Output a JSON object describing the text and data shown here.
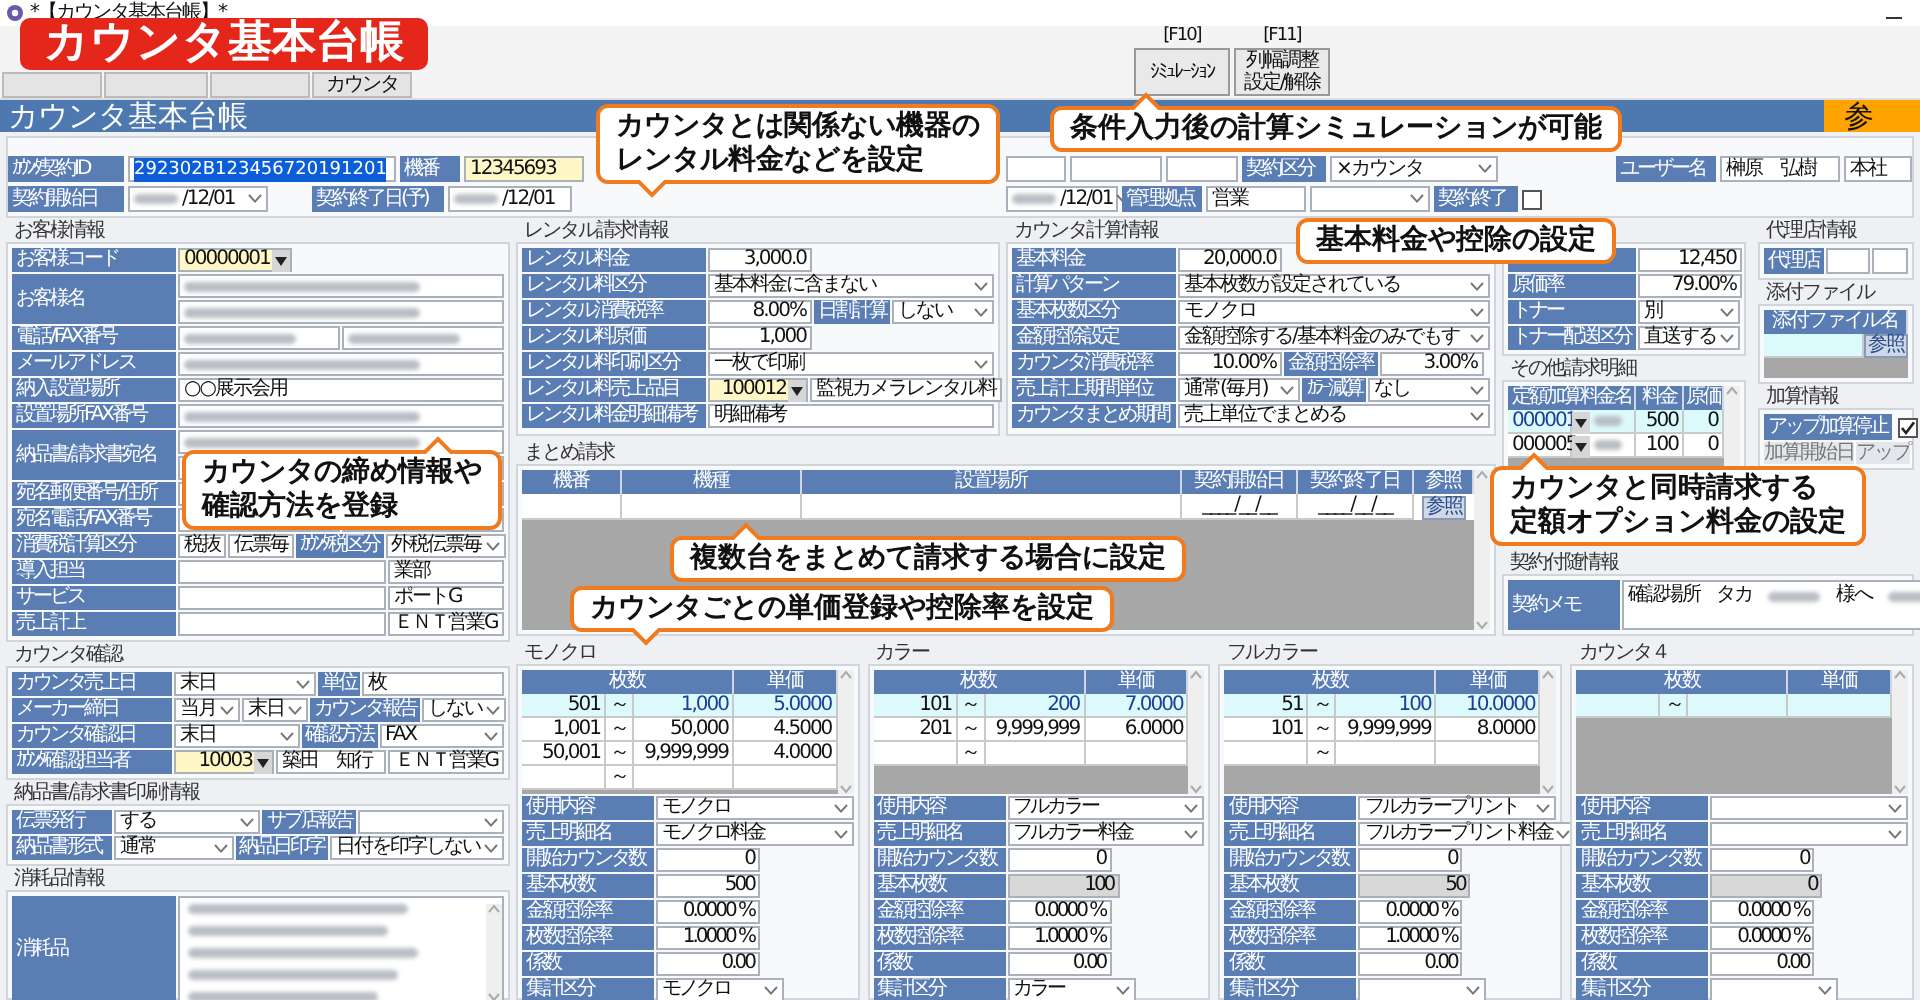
{
  "window": {
    "title": "*【カウンタ基本台帳】*"
  },
  "badge": "カウンタ基本台帳",
  "toolbar": {
    "tab": "カウンタ",
    "buttons": [
      {
        "key": "[F10]",
        "lines": [
          "ｼﾐｭﾚｰｼｮﾝ"
        ]
      },
      {
        "key": "[F11]",
        "lines": [
          "列幅調整",
          "設定/解除"
        ]
      }
    ]
  },
  "header": {
    "title": "カウンタ基本台帳",
    "action": "参"
  },
  "contract": [
    [
      {
        "kind": "label",
        "text": "ｶｳﾝﾀ契約ID"
      },
      {
        "kind": "id",
        "value": "292302B123456720191201"
      },
      {
        "kind": "label",
        "text": "機番"
      },
      {
        "kind": "yellow",
        "value": "12345693"
      },
      {
        "kind": "text"
      },
      {
        "kind": "text"
      },
      {
        "kind": "text"
      },
      {
        "kind": "label",
        "text": "契約区分"
      },
      {
        "kind": "select",
        "value": "×カウンタ"
      },
      {
        "kind": "label",
        "text": "ユーザー名"
      },
      {
        "kind": "text",
        "value": "榊原　弘樹"
      },
      {
        "kind": "text",
        "value": "本社"
      }
    ],
    [
      {
        "kind": "label",
        "text": "契約開始日"
      },
      {
        "kind": "date",
        "value": "/12/01"
      },
      {
        "kind": "label",
        "text": "契約終了日(予)"
      },
      {
        "kind": "date_text",
        "value": "/12/01"
      },
      {
        "kind": "date",
        "value": "/12/01"
      },
      {
        "kind": "label",
        "text": "管理拠点"
      },
      {
        "kind": "text",
        "value": "営業"
      },
      {
        "kind": "select"
      },
      {
        "kind": "label",
        "text": "契約終了"
      },
      {
        "kind": "check",
        "checked": false
      }
    ]
  ],
  "customer": {
    "title": "お客様情報",
    "rows": [
      {
        "label": "お客様コード",
        "lines": [
          [
            {
              "kind": "lookup",
              "value": "00000001"
            }
          ]
        ]
      },
      {
        "label": "お客様名",
        "lines": [
          [
            {
              "kind": "masked"
            }
          ],
          [
            {
              "kind": "masked"
            }
          ]
        ]
      },
      {
        "label": "電話/FAX番号",
        "lines": [
          [
            {
              "kind": "masked"
            },
            {
              "kind": "masked"
            }
          ]
        ]
      },
      {
        "label": "メールアドレス",
        "lines": [
          [
            {
              "kind": "masked"
            }
          ]
        ]
      },
      {
        "label": "納入設置場所",
        "lines": [
          [
            {
              "kind": "text",
              "value": "○○展示会用"
            }
          ]
        ]
      },
      {
        "label": "設置場所FAX番号",
        "lines": [
          [
            {
              "kind": "masked"
            }
          ]
        ]
      },
      {
        "label": "納品書/請求書宛名",
        "lines": [
          [
            {
              "kind": "masked"
            }
          ],
          [
            {
              "kind": "text"
            }
          ]
        ]
      },
      {
        "label": "宛名郵便番号/住所",
        "lines": [
          [
            {
              "kind": "text"
            },
            {
              "kind": "text"
            }
          ]
        ]
      },
      {
        "label": "宛名電話/FAX番号",
        "lines": [
          [
            {
              "kind": "text"
            },
            {
              "kind": "text"
            }
          ]
        ]
      },
      {
        "label": "消費税計算区分",
        "lines": [
          [
            {
              "kind": "text",
              "value": "税抜"
            },
            {
              "kind": "text",
              "value": "伝票毎"
            },
            {
              "kind": "label",
              "text": "ｶｳﾝﾀ税区分"
            },
            {
              "kind": "select",
              "value": "外税伝票毎"
            }
          ]
        ]
      },
      {
        "label": "導入担当",
        "lines": [
          [
            {
              "kind": "text"
            },
            {
              "kind": "tail",
              "value": "業部"
            }
          ]
        ]
      },
      {
        "label": "サービス",
        "lines": [
          [
            {
              "kind": "text"
            },
            {
              "kind": "tail",
              "value": "ポートG"
            }
          ]
        ]
      },
      {
        "label": "売上計上",
        "lines": [
          [
            {
              "kind": "text"
            },
            {
              "kind": "tail",
              "value": "ＥＮＴ営業G"
            }
          ]
        ]
      }
    ]
  },
  "counter_check": {
    "title": "カウンタ確認",
    "rows": [
      {
        "label": "カウンタ売上日",
        "lines": [
          [
            {
              "kind": "select",
              "value": "末日"
            },
            {
              "kind": "label",
              "text": "単位"
            },
            {
              "kind": "text",
              "value": "枚"
            }
          ]
        ]
      },
      {
        "label": "メーカー締日",
        "lines": [
          [
            {
              "kind": "select",
              "value": "当月"
            },
            {
              "kind": "select",
              "value": "末日"
            },
            {
              "kind": "label",
              "text": "カウンタ報告"
            },
            {
              "kind": "select",
              "value": "しない"
            }
          ]
        ]
      },
      {
        "label": "カウンタ確認日",
        "lines": [
          [
            {
              "kind": "select",
              "value": "末日"
            },
            {
              "kind": "label",
              "text": "確認方法"
            },
            {
              "kind": "select",
              "value": "FAX"
            }
          ]
        ]
      },
      {
        "label": "ｶｳﾝﾀ確認担当者",
        "lines": [
          [
            {
              "kind": "lookup",
              "value": "10003"
            },
            {
              "kind": "text",
              "value": "築田　知行"
            },
            {
              "kind": "text",
              "value": "ＥＮＴ営業G"
            }
          ]
        ]
      }
    ]
  },
  "print": {
    "title": "納品書/請求書印刷情報",
    "rows": [
      {
        "label": "伝票発行",
        "lines": [
          [
            {
              "kind": "select",
              "value": "する"
            },
            {
              "kind": "label",
              "text": "サブ店報告"
            },
            {
              "kind": "select"
            }
          ]
        ]
      },
      {
        "label": "納品書形式",
        "lines": [
          [
            {
              "kind": "select",
              "value": "通常"
            },
            {
              "kind": "label",
              "text": "納品日印字"
            },
            {
              "kind": "select",
              "value": "日付を印字しない"
            }
          ]
        ]
      }
    ]
  },
  "supplies": {
    "title": "消耗品情報",
    "label": "消耗品"
  },
  "rental": {
    "title": "レンタル請求情報",
    "rows": [
      {
        "label": "レンタル料金",
        "lines": [
          [
            {
              "kind": "number",
              "value": "3,000.0"
            }
          ]
        ]
      },
      {
        "label": "レンタル料区分",
        "lines": [
          [
            {
              "kind": "select",
              "value": "基本料金に含まない"
            }
          ]
        ]
      },
      {
        "label": "レンタル消費税率",
        "lines": [
          [
            {
              "kind": "number",
              "value": "8.00%"
            },
            {
              "kind": "label",
              "text": "日割計算"
            },
            {
              "kind": "select",
              "value": "しない"
            }
          ]
        ]
      },
      {
        "label": "レンタル料原価",
        "lines": [
          [
            {
              "kind": "number",
              "value": "1,000"
            }
          ]
        ]
      },
      {
        "label": "レンタル料印刷区分",
        "lines": [
          [
            {
              "kind": "select",
              "value": "一枚で印刷"
            }
          ]
        ]
      },
      {
        "label": "レンタル料売上品目",
        "lines": [
          [
            {
              "kind": "lookup",
              "value": "100012"
            },
            {
              "kind": "text",
              "value": "監視カメラレンタル料"
            }
          ]
        ]
      },
      {
        "label": "レンタル料金明細備考",
        "lines": [
          [
            {
              "kind": "text",
              "value": "明細備考"
            }
          ]
        ]
      }
    ]
  },
  "calc": {
    "title": "カウンタ計算情報",
    "rows": [
      {
        "label": "基本料金",
        "lines": [
          [
            {
              "kind": "number",
              "value": "20,000.0"
            }
          ]
        ]
      },
      {
        "label": "計算パターン",
        "lines": [
          [
            {
              "kind": "select",
              "value": "基本枚数が設定されている"
            }
          ]
        ]
      },
      {
        "label": "基本枚数区分",
        "lines": [
          [
            {
              "kind": "select",
              "value": "モノクロ"
            }
          ]
        ]
      },
      {
        "label": "金額控除設定",
        "lines": [
          [
            {
              "kind": "select",
              "value": "金額控除する/基本料金のみでもす"
            }
          ]
        ]
      },
      {
        "label": "カウンタ消費税率",
        "lines": [
          [
            {
              "kind": "number",
              "value": "10.00%"
            },
            {
              "kind": "label",
              "text": "金額控除率"
            },
            {
              "kind": "number",
              "value": "3.00%"
            }
          ]
        ]
      },
      {
        "label": "売上計上期間単位",
        "lines": [
          [
            {
              "kind": "select",
              "value": "通常(毎月)"
            },
            {
              "kind": "label",
              "text": "ｶﾗｰ減算"
            },
            {
              "kind": "select",
              "value": "なし"
            }
          ]
        ]
      },
      {
        "label": "カウンタまとめ期間",
        "lines": [
          [
            {
              "kind": "select",
              "value": "売上単位でまとめる"
            }
          ]
        ]
      }
    ]
  },
  "cost": {
    "rows": [
      {
        "lines": [
          [
            {
              "kind": "number",
              "value": "12,450"
            }
          ]
        ]
      },
      {
        "label": "原価率",
        "lines": [
          [
            {
              "kind": "number",
              "value": "79.00%"
            }
          ]
        ]
      },
      {
        "label": "トナー",
        "lines": [
          [
            {
              "kind": "select",
              "value": "別"
            }
          ]
        ]
      },
      {
        "label": "トナー配送区分",
        "lines": [
          [
            {
              "kind": "select",
              "value": "直送する"
            }
          ]
        ]
      }
    ]
  },
  "summary": {
    "title": "まとめ請求",
    "columns": [
      "機番",
      "機種",
      "設置場所",
      "契約開始日",
      "契約終了日",
      "参照"
    ],
    "rows": [
      {
        "start": "____/__/__",
        "end": "____/__/__",
        "button": "参照"
      }
    ]
  },
  "other_charges": {
    "title": "その他請求明細",
    "columns": [
      "定額加算料金名",
      "料金",
      "原価"
    ],
    "rows": [
      {
        "code": "000001",
        "amount": "500",
        "cost": "0",
        "selected": true
      },
      {
        "code": "000005",
        "amount": "100",
        "cost": "0",
        "selected": false
      }
    ]
  },
  "agency": {
    "title": "代理店情報",
    "label": "代理店"
  },
  "attachments": {
    "title": "添付ファイル",
    "column": "添付ファイル名",
    "button": "参照"
  },
  "addon": {
    "title": "加算情報",
    "stop": "アップ加算停止",
    "checked": true,
    "columns": [
      "加算開始日",
      "アップ"
    ]
  },
  "memo": {
    "title": "契約付随情報",
    "label": "契約メモ",
    "parts": [
      {
        "kind": "text",
        "value": "確認場所"
      },
      {
        "kind": "text",
        "value": "タカ"
      },
      {
        "kind": "masked"
      },
      {
        "kind": "text",
        "value": "様へ"
      },
      {
        "kind": "masked"
      }
    ]
  },
  "counters": [
    {
      "title": "モノクロ",
      "columns": [
        "枚数",
        "単価"
      ],
      "tiers": [
        {
          "from": "501",
          "sep": "～",
          "to": "1,000",
          "price": "5.0000",
          "selected": true
        },
        {
          "from": "1,001",
          "sep": "～",
          "to": "50,000",
          "price": "4.5000",
          "selected": false
        },
        {
          "from": "50,001",
          "sep": "～",
          "to": "9,999,999",
          "price": "4.0000",
          "selected": false
        },
        {
          "sep": "～",
          "selected": false
        }
      ],
      "fields": [
        {
          "label": "使用内容",
          "kind": "select",
          "value": "モノクロ"
        },
        {
          "label": "売上明細名",
          "kind": "select",
          "value": "モノクロ料金"
        },
        {
          "label": "開始カウンタ数",
          "kind": "number",
          "value": "0"
        },
        {
          "label": "基本枚数",
          "kind": "number",
          "value": "500"
        },
        {
          "label": "金額控除率",
          "kind": "number",
          "value": "0.0000 %"
        },
        {
          "label": "枚数控除率",
          "kind": "number",
          "value": "1.0000 %"
        },
        {
          "label": "係数",
          "kind": "number",
          "value": "0.00"
        },
        {
          "label": "集計区分",
          "kind": "short_select",
          "value": "モノクロ"
        }
      ]
    },
    {
      "title": "カラー",
      "columns": [
        "枚数",
        "単価"
      ],
      "tiers": [
        {
          "from": "101",
          "sep": "～",
          "to": "200",
          "price": "7.0000",
          "selected": true
        },
        {
          "from": "201",
          "sep": "～",
          "to": "9,999,999",
          "price": "6.0000",
          "selected": false
        },
        {
          "sep": "～",
          "selected": false
        }
      ],
      "fields": [
        {
          "label": "使用内容",
          "kind": "select",
          "value": "フルカラー"
        },
        {
          "label": "売上明細名",
          "kind": "select",
          "value": "フルカラー料金"
        },
        {
          "label": "開始カウンタ数",
          "kind": "number",
          "value": "0"
        },
        {
          "label": "基本枚数",
          "kind": "fixed",
          "value": "100"
        },
        {
          "label": "金額控除率",
          "kind": "number",
          "value": "0.0000 %"
        },
        {
          "label": "枚数控除率",
          "kind": "number",
          "value": "1.0000 %"
        },
        {
          "label": "係数",
          "kind": "number",
          "value": "0.00"
        },
        {
          "label": "集計区分",
          "kind": "short_select",
          "value": "カラー"
        }
      ]
    },
    {
      "title": "フルカラー",
      "columns": [
        "枚数",
        "単価"
      ],
      "tiers": [
        {
          "from": "51",
          "sep": "～",
          "to": "100",
          "price": "10.0000",
          "selected": true
        },
        {
          "from": "101",
          "sep": "～",
          "to": "9,999,999",
          "price": "8.0000",
          "selected": false
        },
        {
          "sep": "～",
          "selected": false
        }
      ],
      "fields": [
        {
          "label": "使用内容",
          "kind": "select",
          "value": "フルカラープリント"
        },
        {
          "label": "売上明細名",
          "kind": "select",
          "value": "フルカラープリント料金"
        },
        {
          "label": "開始カウンタ数",
          "kind": "number",
          "value": "0"
        },
        {
          "label": "基本枚数",
          "kind": "fixed",
          "value": "50"
        },
        {
          "label": "金額控除率",
          "kind": "number",
          "value": "0.0000 %"
        },
        {
          "label": "枚数控除率",
          "kind": "number",
          "value": "1.0000 %"
        },
        {
          "label": "係数",
          "kind": "number",
          "value": "0.00"
        },
        {
          "label": "集計区分",
          "kind": "short_select"
        }
      ]
    },
    {
      "title": "カウンタ４",
      "columns": [
        "枚数",
        "単価"
      ],
      "tiers": [
        {
          "sep": "～",
          "selected": true
        }
      ],
      "fields": [
        {
          "label": "使用内容",
          "kind": "select"
        },
        {
          "label": "売上明細名",
          "kind": "select"
        },
        {
          "label": "開始カウンタ数",
          "kind": "number",
          "value": "0"
        },
        {
          "label": "基本枚数",
          "kind": "fixed",
          "value": "0"
        },
        {
          "label": "金額控除率",
          "kind": "number",
          "value": "0.0000 %"
        },
        {
          "label": "枚数控除率",
          "kind": "number",
          "value": "0.0000 %"
        },
        {
          "label": "係数",
          "kind": "number",
          "value": "0.00"
        },
        {
          "label": "集計区分",
          "kind": "short_select"
        }
      ]
    }
  ],
  "callouts": [
    {
      "lines": [
        "カウンタとは関係ない機器の",
        "レンタル料金などを設定"
      ]
    },
    {
      "lines": [
        "条件入力後の計算シミュレーションが可能"
      ]
    },
    {
      "lines": [
        "基本料金や控除の設定"
      ]
    },
    {
      "lines": [
        "複数台をまとめて請求する場合に設定"
      ]
    },
    {
      "lines": [
        "カウンタの締め情報や",
        "確認方法を登録"
      ]
    },
    {
      "lines": [
        "カウンタごとの単価登録や控除率を設定"
      ]
    },
    {
      "lines": [
        "カウンタと同時請求する",
        "定額オプション料金の設定"
      ]
    }
  ]
}
